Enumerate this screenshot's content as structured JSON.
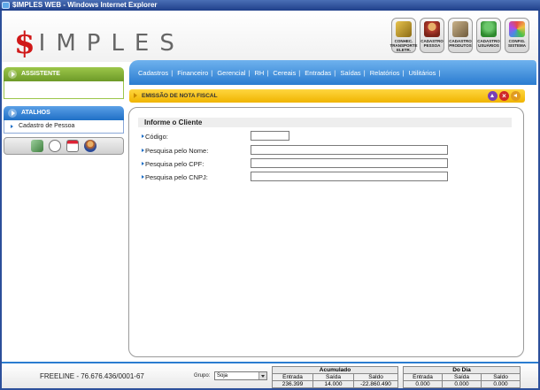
{
  "window": {
    "title": "$IMPLES WEB - Windows Internet Explorer"
  },
  "logo": {
    "dollar": "$",
    "rest": "IMPLES"
  },
  "toolbar": [
    {
      "name": "conhec-transporte-button",
      "icon": "truck-icon",
      "label": "CONHEC. TRANSPORTE ELETR.",
      "icon_class": "ic-truck"
    },
    {
      "name": "cadastro-pessoa-button",
      "icon": "person-icon",
      "label": "CADASTRO PESSOA",
      "icon_class": "ic-person"
    },
    {
      "name": "cadastro-produtos-button",
      "icon": "box-icon",
      "label": "CADASTRO PRODUTOS",
      "icon_class": "ic-box"
    },
    {
      "name": "cadastro-usuarios-button",
      "icon": "users-icon",
      "label": "CADASTRO USUÁRIOS",
      "icon_class": "ic-users"
    },
    {
      "name": "config-sistema-button",
      "icon": "config-icon",
      "label": "CONFIG. SISTEMA",
      "icon_class": "ic-config"
    }
  ],
  "sidebar": {
    "assistente": "ASSISTENTE",
    "atalhos": "ATALHOS",
    "atalho_items": [
      "Cadastro de Pessoa"
    ]
  },
  "menu": [
    "Cadastros",
    "Financeiro",
    "Gerencial",
    "RH",
    "Cereais",
    "Entradas",
    "Saídas",
    "Relatórios",
    "Utilitários"
  ],
  "section": {
    "title": "EMISSÃO DE NOTA FISCAL"
  },
  "form": {
    "title": "Informe o Cliente",
    "fields": [
      {
        "label": "Código:",
        "value": ""
      },
      {
        "label": "Pesquisa pelo Nome:",
        "value": ""
      },
      {
        "label": "Pesquisa pelo CPF:",
        "value": ""
      },
      {
        "label": "Pesquisa pelo CNPJ:",
        "value": ""
      }
    ]
  },
  "footer": {
    "freeline": "FREELINE  -  76.676.436/0001-67",
    "grupo_label": "Grupo:",
    "grupo_value": "Soja",
    "acumulado": {
      "title": "Acumulado",
      "headers": [
        "Entrada",
        "Saída",
        "Saldo"
      ],
      "values": [
        "236.399",
        "14.000",
        "-22.860.490"
      ]
    },
    "do_dia": {
      "title": "Do Dia",
      "headers": [
        "Entrada",
        "Saída",
        "Saldo"
      ],
      "values": [
        "0.000",
        "0.000",
        "0.000"
      ]
    }
  }
}
